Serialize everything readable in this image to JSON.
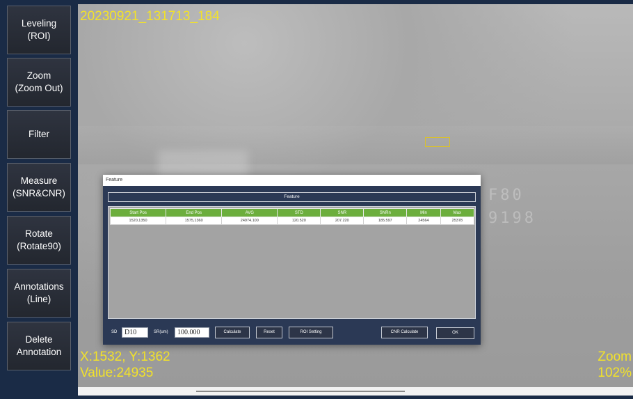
{
  "sidebar": {
    "buttons": [
      {
        "line1": "Leveling",
        "line2": "(ROI)"
      },
      {
        "line1": "Zoom",
        "line2": "(Zoom Out)"
      },
      {
        "line1": "Filter",
        "line2": ""
      },
      {
        "line1": "Measure",
        "line2": "(SNR&CNR)"
      },
      {
        "line1": "Rotate",
        "line2": "(Rotate90)"
      },
      {
        "line1": "Annotations",
        "line2": "(Line)"
      },
      {
        "line1": "Delete",
        "line2": "Annotation"
      }
    ]
  },
  "viewer": {
    "image_name": "20230921_131713_184",
    "coords": "X:1532, Y:1362",
    "value": "Value:24935",
    "zoom_label": "Zoom",
    "zoom_value": "102%"
  },
  "dialog": {
    "title": "Feature",
    "section_title": "Feature",
    "columns": [
      "Start Pos",
      "End Pos",
      "AVG",
      "STD",
      "SNR",
      "SNRn",
      "Min",
      "Max"
    ],
    "rows": [
      [
        "1520,1350",
        "1575,1360",
        "24974.100",
        "120.520",
        "207.220",
        "185.597",
        "24564",
        "25378"
      ]
    ],
    "sd_label": "SD",
    "sd_value": "D10",
    "sr_label": "SR(um)",
    "sr_value": "100.000",
    "calculate_label": "Calculate",
    "reset_label": "Reset",
    "roi_setting_label": "ROI Setting",
    "cnr_calculate_label": "CNR Calculate",
    "ok_label": "OK"
  },
  "colors": {
    "overlay_text": "#f2e22a",
    "header_green": "#6cae3d",
    "dialog_bg": "#2b3955",
    "sidebar_bg": "#1a2b46"
  }
}
